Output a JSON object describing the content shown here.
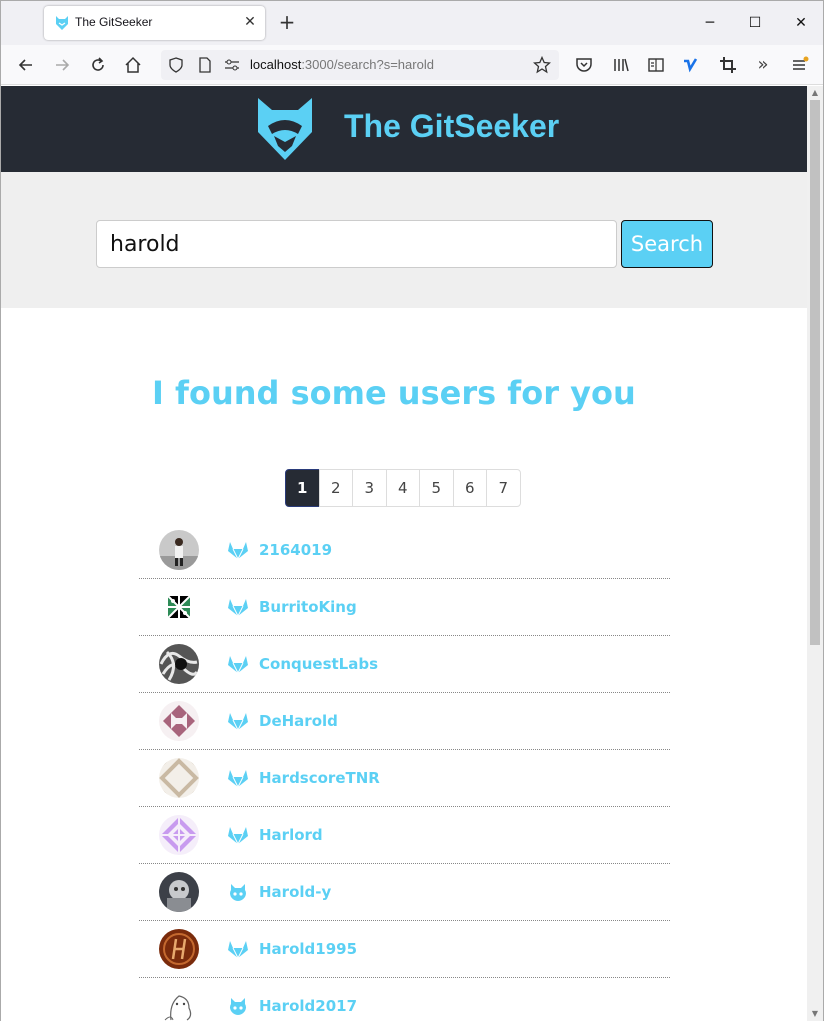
{
  "browser": {
    "tab_title": "The GitSeeker",
    "url_host": "localhost",
    "url_rest": ":3000/search?s=harold"
  },
  "app": {
    "brand": "The GitSeeker",
    "brand_color": "#5bd0f4",
    "header_bg": "#262b34"
  },
  "search": {
    "value": "harold",
    "button_label": "Search"
  },
  "results": {
    "heading": "I found some users for you",
    "pages": [
      "1",
      "2",
      "3",
      "4",
      "5",
      "6",
      "7"
    ],
    "active_page": "1",
    "users": [
      {
        "name": "2164019",
        "source": "gitlab-icon",
        "avatar": "photo-person"
      },
      {
        "name": "BurritoKing",
        "source": "gitlab-icon",
        "avatar": "identicon-green"
      },
      {
        "name": "ConquestLabs",
        "source": "gitlab-icon",
        "avatar": "photo-bw"
      },
      {
        "name": "DeHarold",
        "source": "gitlab-icon",
        "avatar": "identicon-mauve"
      },
      {
        "name": "HardscoreTNR",
        "source": "gitlab-icon",
        "avatar": "identicon-tan"
      },
      {
        "name": "Harlord",
        "source": "gitlab-icon",
        "avatar": "identicon-violet"
      },
      {
        "name": "Harold-y",
        "source": "github-icon",
        "avatar": "photo-gray"
      },
      {
        "name": "Harold1995",
        "source": "gitlab-icon",
        "avatar": "letter-h-brown"
      },
      {
        "name": "Harold2017",
        "source": "github-icon",
        "avatar": "sketch"
      }
    ]
  }
}
